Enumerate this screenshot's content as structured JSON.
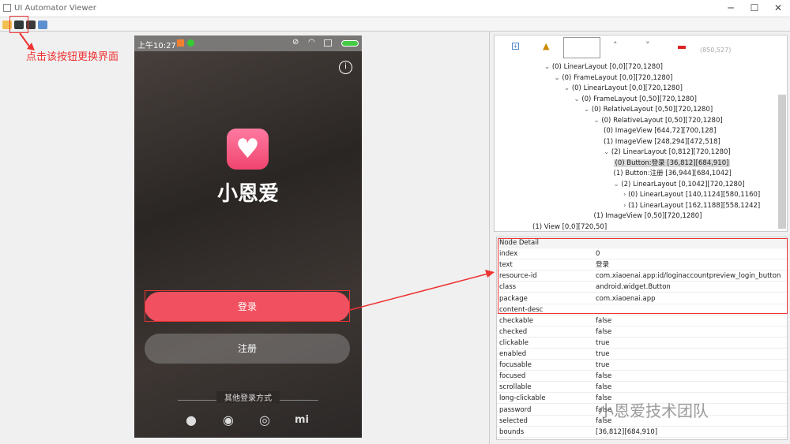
{
  "window": {
    "title": "UI Automator Viewer",
    "minimize": "─",
    "maximize": "☐",
    "close": "✕"
  },
  "annotation": {
    "hint": "点击该按钮更换界面",
    "watermark": "小恩爱技术团队"
  },
  "phone": {
    "time": "上午10:27",
    "app_name": "小恩爱",
    "login": "登录",
    "register": "注册",
    "other_login": "其他登录方式",
    "info": "i"
  },
  "tree_toolbar": {
    "coords": "(850,527)"
  },
  "tree": [
    {
      "label": "(0) LinearLayout [0,0][720,1280]",
      "level": 0,
      "expand": "open"
    },
    {
      "label": "(0) FrameLayout [0,0][720,1280]",
      "level": 1,
      "expand": "open"
    },
    {
      "label": "(0) LinearLayout [0,0][720,1280]",
      "level": 2,
      "expand": "open"
    },
    {
      "label": "(0) FrameLayout [0,50][720,1280]",
      "level": 3,
      "expand": "open"
    },
    {
      "label": "(0) RelativeLayout [0,50][720,1280]",
      "level": 4,
      "expand": "open"
    },
    {
      "label": "(0) RelativeLayout [0,50][720,1280]",
      "level": 5,
      "expand": "open"
    },
    {
      "label": "(0) ImageView [644,72][700,128]",
      "level": 6,
      "expand": ""
    },
    {
      "label": "(1) ImageView [248,294][472,518]",
      "level": 6,
      "expand": ""
    },
    {
      "label": "(2) LinearLayout [0,812][720,1280]",
      "level": 6,
      "expand": "open"
    },
    {
      "label": "(0) Button:登录 [36,812][684,910]",
      "level": 7,
      "expand": "",
      "selected": true
    },
    {
      "label": "(1) Button:注册 [36,944][684,1042]",
      "level": 7,
      "expand": ""
    },
    {
      "label": "(2) LinearLayout [0,1042][720,1280]",
      "level": 7,
      "expand": "open"
    },
    {
      "label": "(0) LinearLayout [140,1124][580,1160]",
      "level": 8,
      "expand": "closed"
    },
    {
      "label": "(1) LinearLayout [162,1188][558,1242]",
      "level": 8,
      "expand": "closed"
    },
    {
      "label": "(1) ImageView [0,50][720,1280]",
      "level": 5,
      "expand": ""
    },
    {
      "label": "(1) View [0,0][720,50]",
      "level": 0,
      "expand": ""
    }
  ],
  "detail": {
    "header": "Node Detail",
    "rows": [
      [
        "index",
        "0"
      ],
      [
        "text",
        "登录"
      ],
      [
        "resource-id",
        "com.xiaoenai.app:id/loginaccountpreview_login_button"
      ],
      [
        "class",
        "android.widget.Button"
      ],
      [
        "package",
        "com.xiaoenai.app"
      ],
      [
        "content-desc",
        ""
      ],
      [
        "checkable",
        "false"
      ],
      [
        "checked",
        "false"
      ],
      [
        "clickable",
        "true"
      ],
      [
        "enabled",
        "true"
      ],
      [
        "focusable",
        "true"
      ],
      [
        "focused",
        "false"
      ],
      [
        "scrollable",
        "false"
      ],
      [
        "long-clickable",
        "false"
      ],
      [
        "password",
        "false"
      ],
      [
        "selected",
        "false"
      ],
      [
        "bounds",
        "[36,812][684,910]"
      ]
    ]
  }
}
